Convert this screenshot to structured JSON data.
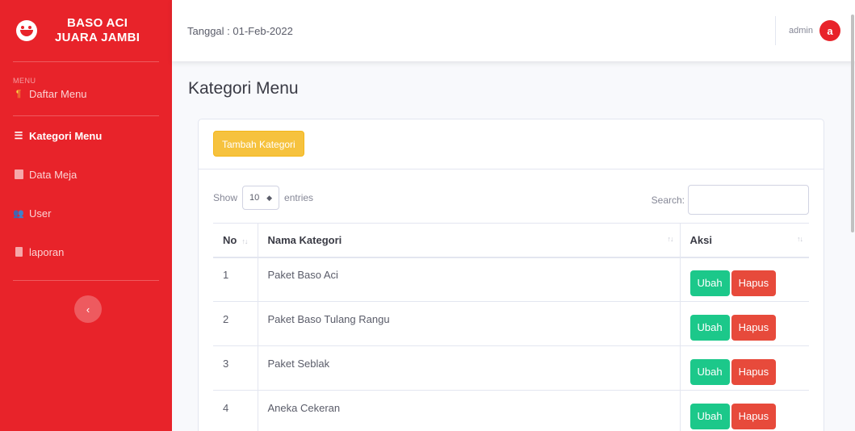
{
  "brand": {
    "line1": "BASO ACI",
    "line2": "JUARA JAMBI",
    "icon": "laughing-face-icon"
  },
  "sidebar": {
    "heading": "MENU",
    "items": [
      {
        "label": "Daftar Menu",
        "icon": "utensils-icon",
        "active": false
      },
      {
        "label": "Kategori Menu",
        "icon": "list-icon",
        "active": true
      },
      {
        "label": "Data Meja",
        "icon": "table-icon",
        "active": false
      },
      {
        "label": "User",
        "icon": "users-icon",
        "active": false
      },
      {
        "label": "laporan",
        "icon": "file-icon",
        "active": false
      }
    ],
    "toggle_icon": "chevron-left-icon"
  },
  "topbar": {
    "date": "Tanggal : 01-Feb-2022",
    "username": "admin",
    "avatar_letter": "a"
  },
  "main": {
    "title": "Kategori Menu",
    "add_button": "Tambah Kategori",
    "show_label": "Show",
    "entries_value": "10",
    "entries_label": "entries",
    "search_label": "Search:",
    "search_value": ""
  },
  "table": {
    "headers": [
      "No",
      "Nama Kategori",
      "Aksi"
    ],
    "rows": [
      {
        "no": "1",
        "nama": "Paket Baso Aci"
      },
      {
        "no": "2",
        "nama": "Paket Baso Tulang Rangu"
      },
      {
        "no": "3",
        "nama": "Paket Seblak"
      },
      {
        "no": "4",
        "nama": "Aneka Cekeran"
      }
    ],
    "edit_label": "Ubah",
    "delete_label": "Hapus"
  },
  "colors": {
    "sidebar": "#e8232a",
    "add_button": "#f6c23e",
    "edit_button": "#1cc88a",
    "delete_button": "#e74a3b"
  }
}
